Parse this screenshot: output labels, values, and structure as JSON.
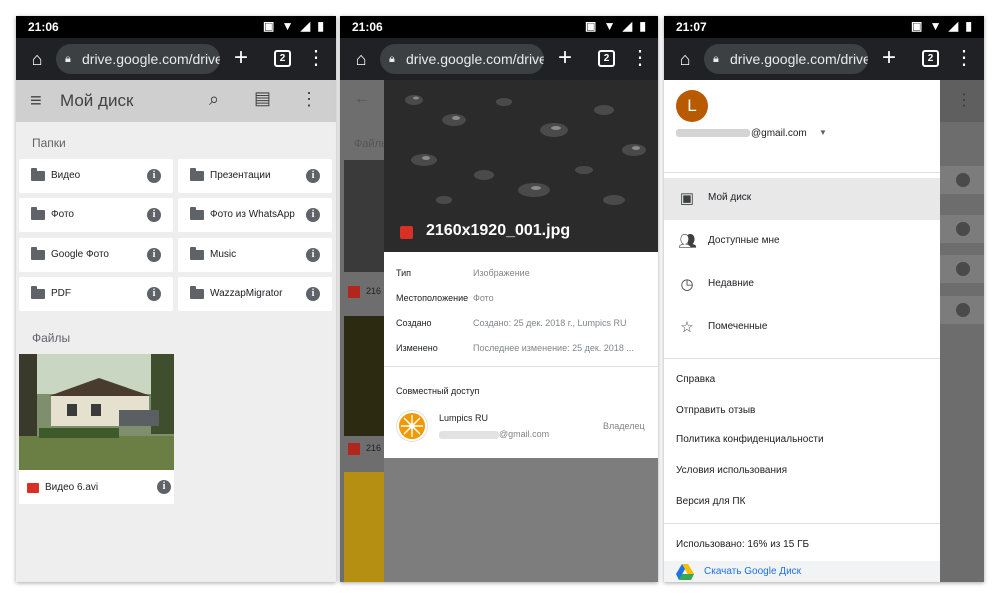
{
  "panels": [
    {
      "status": {
        "time": "21:06"
      },
      "browser": {
        "url": "drive.google.com/drive/",
        "tab_count": "2"
      },
      "appbar": {
        "title": "Мой диск"
      },
      "folders_label": "Папки",
      "folders": [
        {
          "name": "Видео"
        },
        {
          "name": "Презентации"
        },
        {
          "name": "Фото"
        },
        {
          "name": "Фото из WhatsApp"
        },
        {
          "name": "Google Фото"
        },
        {
          "name": "Music"
        },
        {
          "name": "PDF"
        },
        {
          "name": "WazzapMigrator"
        }
      ],
      "files_label": "Файлы",
      "files": [
        {
          "name": "Видео 6.avi"
        }
      ]
    },
    {
      "status": {
        "time": "21:06"
      },
      "browser": {
        "url": "drive.google.com/drive/",
        "tab_count": "2"
      },
      "background_labels": {
        "files": "Файлы",
        "item1": "216",
        "item2": "216"
      },
      "details": {
        "file_name": "2160x1920_001.jpg",
        "rows": [
          {
            "label": "Тип",
            "value": "Изображение"
          },
          {
            "label": "Местоположение",
            "value": "Фото"
          },
          {
            "label": "Создано",
            "value": "Создано: 25 дек. 2018 г., Lumpics RU"
          },
          {
            "label": "Изменено",
            "value": "Последнее изменение: 25 дек. 2018 ..."
          }
        ],
        "sharing_title": "Совместный доступ",
        "owner_name": "Lumpics RU",
        "owner_email_domain": "@gmail.com",
        "owner_role": "Владелец"
      }
    },
    {
      "status": {
        "time": "21:07"
      },
      "browser": {
        "url": "drive.google.com/drive/",
        "tab_count": "2"
      },
      "account": {
        "initial": "L",
        "email_domain": "@gmail.com"
      },
      "nav": [
        {
          "label": "Мой диск",
          "icon": "drive-icon"
        },
        {
          "label": "Доступные мне",
          "icon": "people-icon"
        },
        {
          "label": "Недавние",
          "icon": "clock-icon"
        },
        {
          "label": "Помеченные",
          "icon": "star-icon"
        }
      ],
      "links": [
        {
          "label": "Справка"
        },
        {
          "label": "Отправить отзыв"
        },
        {
          "label": "Политика конфиденциальности"
        },
        {
          "label": "Условия использования"
        },
        {
          "label": "Версия для ПК"
        }
      ],
      "usage": "Использовано: 16% из 15 ГБ",
      "download_label": "Скачать Google Диск"
    }
  ]
}
